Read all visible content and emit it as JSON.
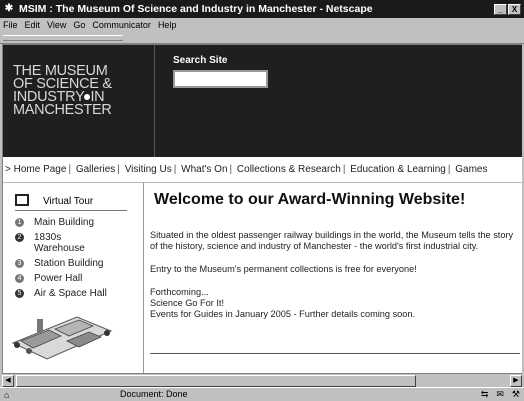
{
  "window": {
    "title": "MSIM : The Museum Of Science and Industry in Manchester - Netscape",
    "app_icon": "netscape-icon",
    "buttons": [
      "_",
      "X"
    ]
  },
  "menu": [
    "File",
    "Edit",
    "View",
    "Go",
    "Communicator",
    "Help"
  ],
  "header": {
    "logo_lines": [
      "THE MUSEUM",
      "OF SCIENCE &",
      "INDUSTRY",
      "IN",
      "MANCHESTER"
    ],
    "search_label": "Search Site",
    "search_value": ""
  },
  "nav": {
    "prefix": ">",
    "links": [
      "Home Page",
      "Galleries",
      "Visiting Us",
      "What's On",
      "Collections & Research",
      "Education & Learning",
      "Games"
    ]
  },
  "sidebar": {
    "virtual_tour": "Virtual Tour",
    "items": [
      {
        "num": "1",
        "label": "Main Building"
      },
      {
        "num": "2",
        "label": "1830s Warehouse"
      },
      {
        "num": "3",
        "label": "Station Building"
      },
      {
        "num": "4",
        "label": "Power Hall"
      },
      {
        "num": "5",
        "label": "Air & Space Hall"
      }
    ]
  },
  "main": {
    "heading": "Welcome to our Award-Winning Website!",
    "para1": "Situated in the oldest passenger railway buildings in the world, the Museum tells the story of the history, science and industry of Manchester - the world's first industrial city.",
    "para2": "Entry to the Museum's permanent collections is free for everyone!",
    "forthcoming": "Forthcoming...",
    "event1": "Science Go For It!",
    "event2": "Events for Guides in January 2005 - Further details coming soon."
  },
  "status": {
    "text": "Document: Done"
  }
}
